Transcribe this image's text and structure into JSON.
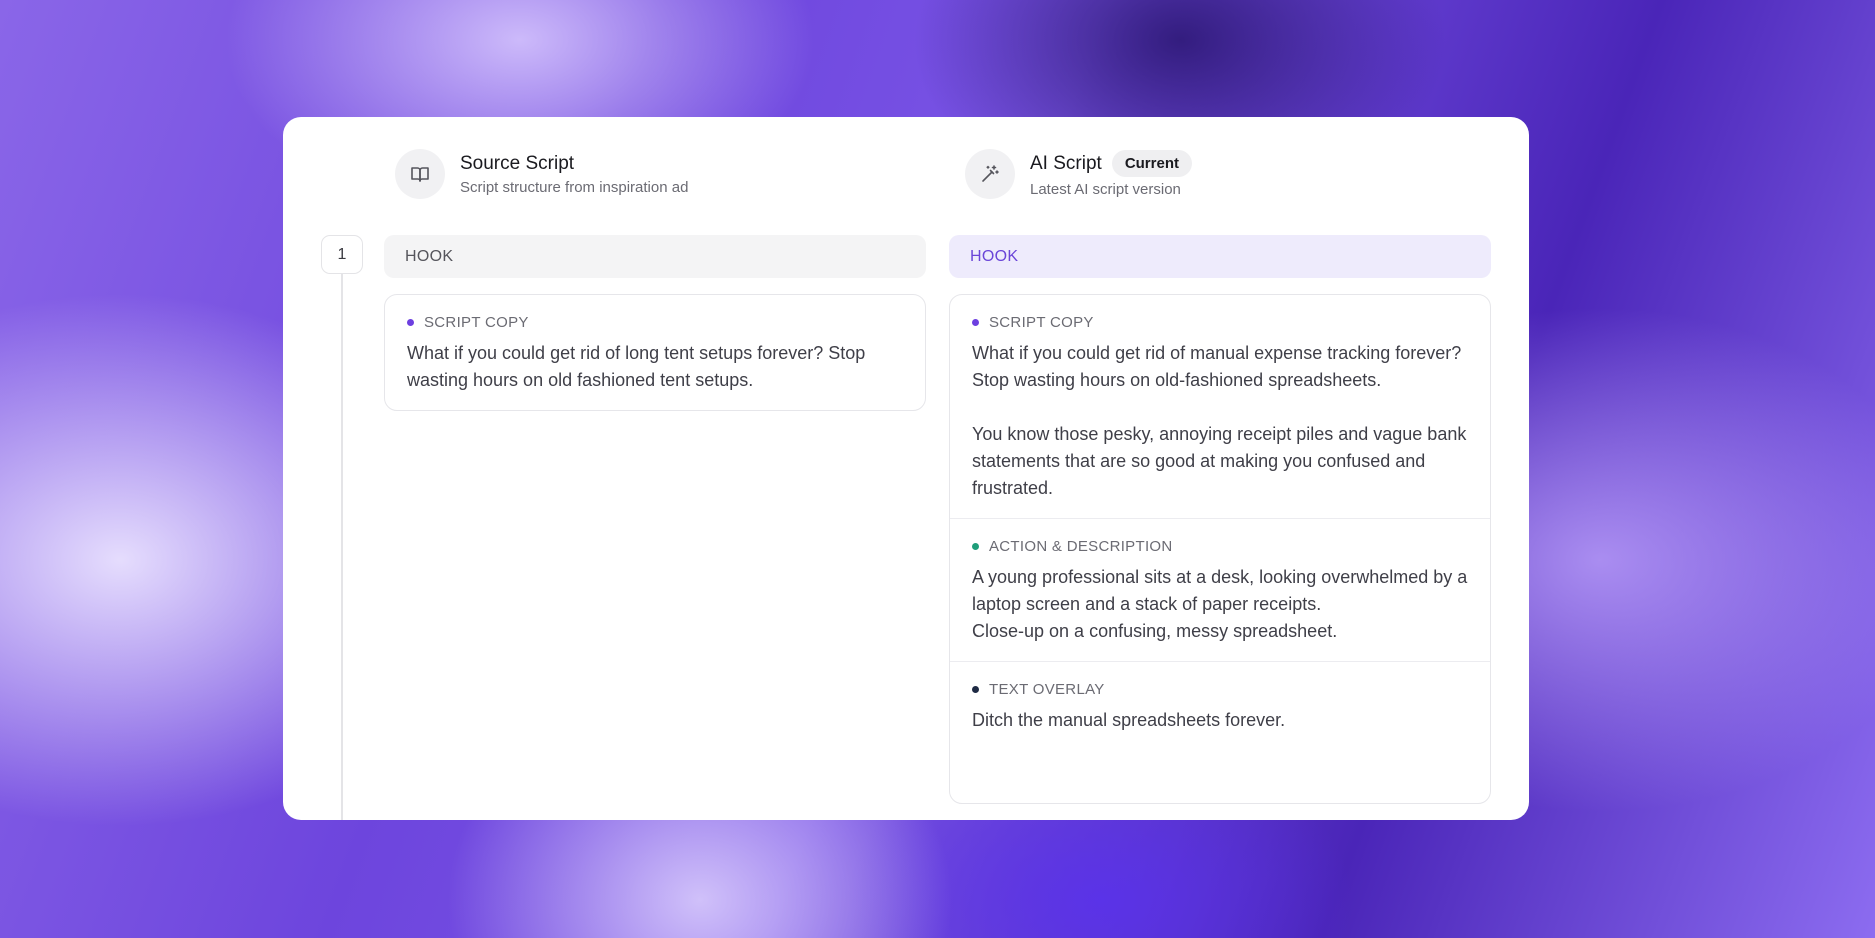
{
  "source": {
    "title": "Source Script",
    "subtitle": "Script structure from inspiration ad",
    "icon": "book-icon"
  },
  "ai": {
    "title": "AI Script",
    "badge": "Current",
    "subtitle": "Latest AI script version",
    "icon": "magic-wand-icon"
  },
  "step": {
    "number": "1"
  },
  "sections": {
    "left_label": "HOOK",
    "right_label": "HOOK"
  },
  "left_blocks": [
    {
      "label": "SCRIPT COPY",
      "dot_color": "#6d3fe0",
      "text": "What if you could get rid of long tent setups forever? Stop wasting hours on old fashioned tent setups."
    }
  ],
  "right_blocks": [
    {
      "label": "SCRIPT COPY",
      "dot_color": "#6d3fe0",
      "text": "What if you could get rid of manual expense tracking forever? Stop wasting hours on old-fashioned spreadsheets.\n\nYou know those pesky, annoying receipt piles and vague bank statements that are so good at making you confused and frustrated."
    },
    {
      "label": "ACTION & DESCRIPTION",
      "dot_color": "#1f9e7a",
      "text": "A young professional sits at a desk, looking overwhelmed by a laptop screen and a stack of paper receipts.\nClose-up on a confusing, messy spreadsheet."
    },
    {
      "label": "TEXT OVERLAY",
      "dot_color": "#1e2a44",
      "text": "Ditch the manual spreadsheets forever."
    }
  ],
  "colors": {
    "accent": "#6a45d8",
    "accent_bg": "#eeebfc"
  }
}
